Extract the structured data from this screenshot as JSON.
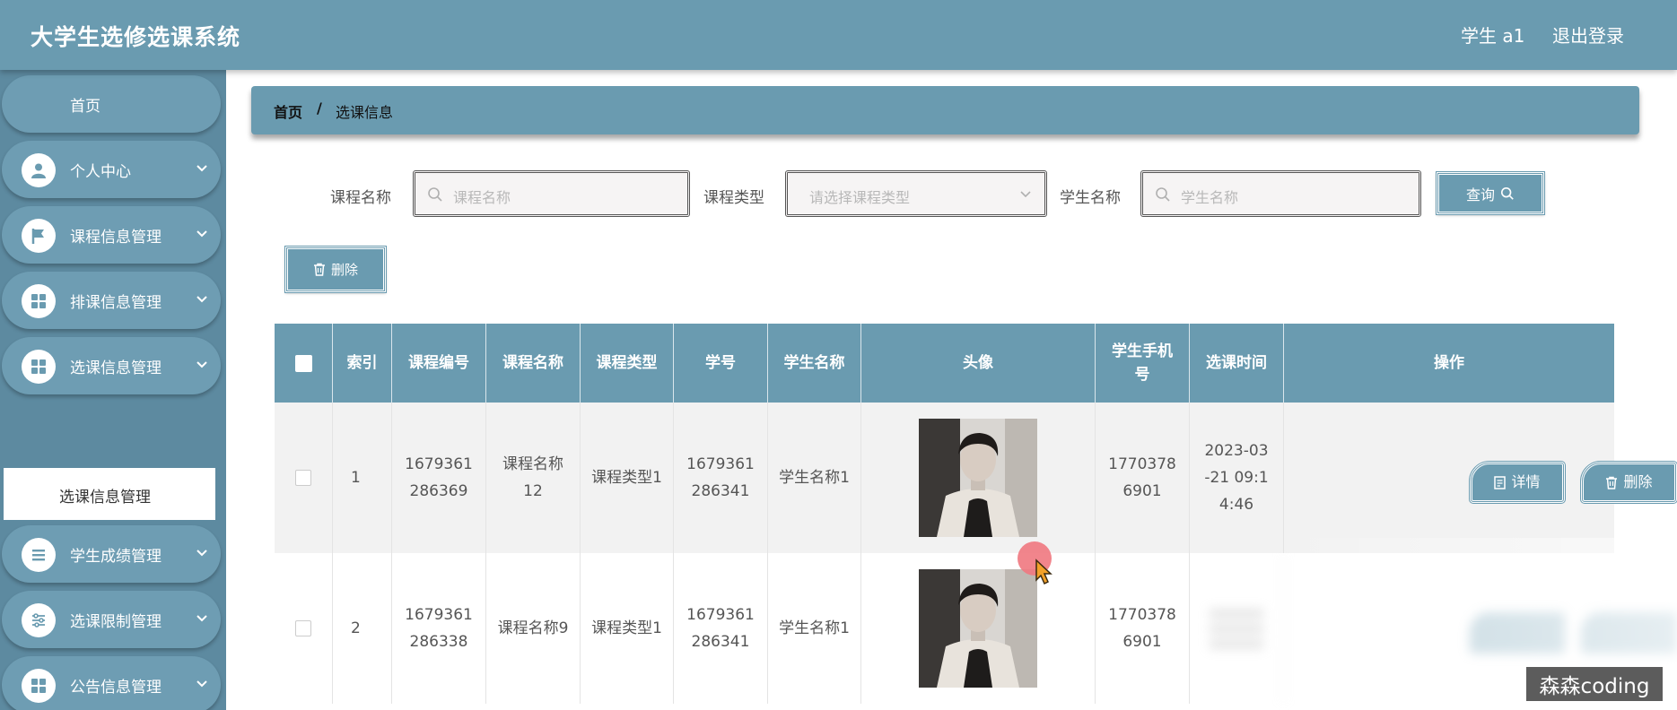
{
  "header": {
    "title": "大学生选修选课系统",
    "user": "学生 a1",
    "logout": "退出登录"
  },
  "sidebar": {
    "items": [
      {
        "label": "首页",
        "icon": "none"
      },
      {
        "label": "个人中心",
        "icon": "user-icon"
      },
      {
        "label": "课程信息管理",
        "icon": "flag-icon"
      },
      {
        "label": "排课信息管理",
        "icon": "grid-icon"
      },
      {
        "label": "选课信息管理",
        "icon": "grid-icon"
      },
      {
        "label": "学生成绩管理",
        "icon": "list-icon"
      },
      {
        "label": "选课限制管理",
        "icon": "sliders-icon"
      },
      {
        "label": "公告信息管理",
        "icon": "grid-icon"
      }
    ],
    "submenu": {
      "label": "选课信息管理"
    }
  },
  "breadcrumb": {
    "home": "首页",
    "separator": "/",
    "current": "选课信息"
  },
  "search": {
    "course_name_label": "课程名称",
    "course_name_placeholder": "课程名称",
    "course_type_label": "课程类型",
    "course_type_placeholder": "请选择课程类型",
    "student_name_label": "学生名称",
    "student_name_placeholder": "学生名称",
    "query_label": "查询"
  },
  "toolbar": {
    "delete_label": "删除"
  },
  "table": {
    "headers": {
      "index": "索引",
      "course_no": "课程编号",
      "course_name": "课程名称",
      "course_type": "课程类型",
      "student_no": "学号",
      "student_name": "学生名称",
      "avatar": "头像",
      "phone": "学生手机号",
      "time": "选课时间",
      "ops": "操作"
    },
    "rows": [
      {
        "index": "1",
        "course_no": "1679361286369",
        "course_name": "课程名称12",
        "course_type": "课程类型1",
        "student_no": "1679361286341",
        "student_name": "学生名称1",
        "phone": "17703786901",
        "time": "2023-03-21 09:14:46",
        "detail_label": "详情",
        "delete_label": "删除"
      },
      {
        "index": "2",
        "course_no": "1679361286338",
        "course_name": "课程名称9",
        "course_type": "课程类型1",
        "student_no": "1679361286341",
        "student_name": "学生名称1",
        "phone": "17703786901"
      }
    ]
  },
  "watermark": "森森coding",
  "colors": {
    "primary": "#6a9bb0",
    "sidebar": "#5d8aa0",
    "cursor": "#f07880"
  }
}
